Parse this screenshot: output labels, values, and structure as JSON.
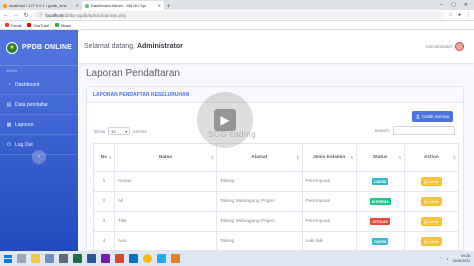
{
  "browser": {
    "tabs": [
      {
        "title": "localhost / 127.0.0.1 / ppdb_smk",
        "active": false
      },
      {
        "title": "Dashboard Admin - MA NU Spr",
        "active": true
      }
    ],
    "url_host": "localhost",
    "url_path": "/daftar-ppdb/admin/laporan.php",
    "bookmarks": [
      "Gmail",
      "YouTube",
      "Maps"
    ]
  },
  "sidebar": {
    "brand": "PPDB ONLINE",
    "heading": "ADMIN",
    "items": [
      {
        "label": "Dashboard",
        "icon": "dashboard-icon"
      },
      {
        "label": "Data pendaftar",
        "icon": "users-icon"
      },
      {
        "label": "Laporan",
        "icon": "report-icon"
      },
      {
        "label": "Log Out",
        "icon": "logout-icon"
      }
    ],
    "toggle": "‹"
  },
  "topbar": {
    "welcome_prefix": "Selamat datang,",
    "welcome_name": "Administrator",
    "user_name": "Administrator"
  },
  "page": {
    "title": "Laporan Pendaftaran"
  },
  "card": {
    "title": "LAPORAN PENDAFTAR KESELURUHAN",
    "print_all_label": "Cetak Semua",
    "show_label": "Show",
    "entries_value": "10",
    "entries_label": "entries",
    "search_label": "Search:"
  },
  "table": {
    "headers": [
      "No",
      "Nama",
      "Alamat",
      "Jenis Kelamin",
      "Status",
      "Action"
    ],
    "rows": [
      {
        "no": "1",
        "nama": "Annas",
        "alamat": "Talang",
        "jk": "Perempuan",
        "status": "DIARSI",
        "status_color": "#36b9cc",
        "action": "Cetak"
      },
      {
        "no": "2",
        "nama": "Ali",
        "alamat": "Talang Waluagung Prigen",
        "jk": "Perempuan",
        "status": "DITERIMA",
        "status_color": "#1cc88a",
        "action": "Cetak"
      },
      {
        "no": "3",
        "nama": "Tilla",
        "alamat": "Talang Waluagung Prigen",
        "jk": "Perempuan",
        "status": "DITOLAK",
        "status_color": "#e74a3b",
        "action": "Cetak"
      },
      {
        "no": "4",
        "nama": "Aan",
        "alamat": "Talang",
        "jk": "Laki-laki",
        "status": "DIARSI",
        "status_color": "#36b9cc",
        "action": "Cetak"
      }
    ]
  },
  "watermark": "SCG coding",
  "taskbar": {
    "time": "09:28",
    "date": "15/06/2022"
  }
}
